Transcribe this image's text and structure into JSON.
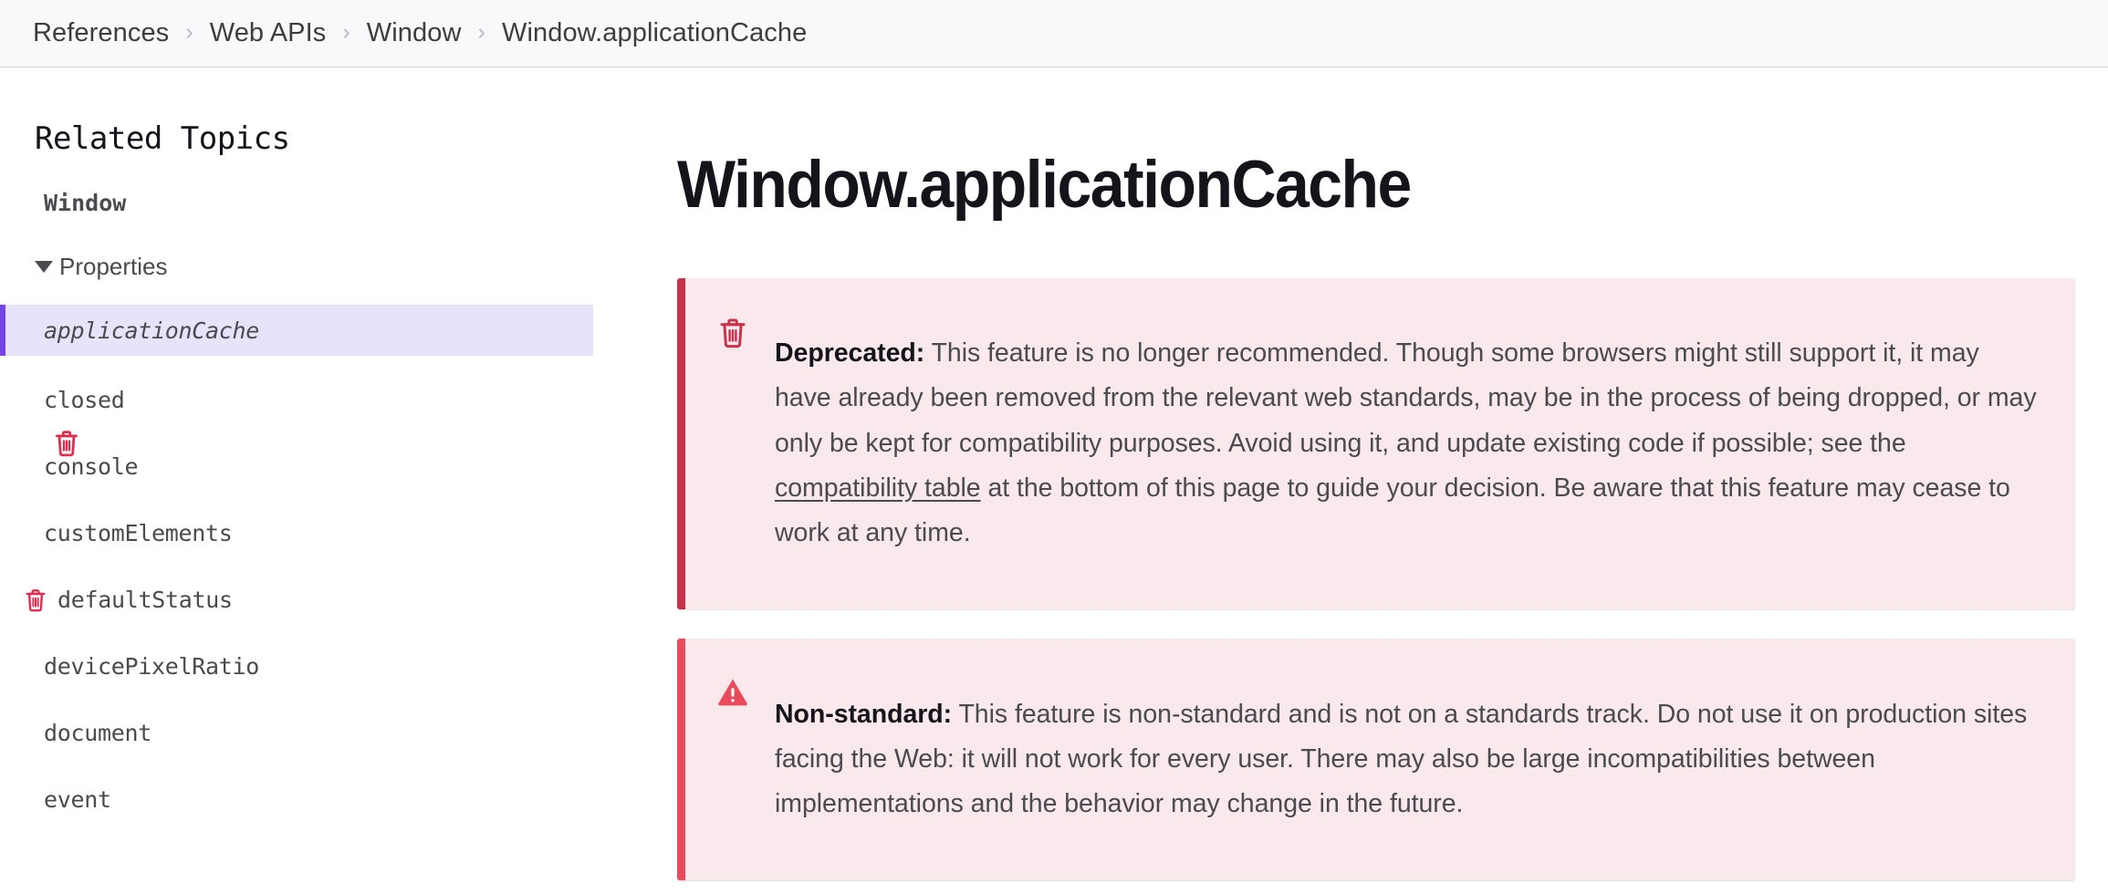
{
  "breadcrumb": {
    "separator": "›",
    "items": [
      {
        "label": "References",
        "current": false
      },
      {
        "label": "Web APIs",
        "current": false
      },
      {
        "label": "Window",
        "current": false
      },
      {
        "label": "Window.applicationCache",
        "current": true
      }
    ]
  },
  "sidebar": {
    "title": "Related Topics",
    "group_title": "Window",
    "section": {
      "label": "Properties",
      "expanded": true,
      "icon": "triangle-down-icon"
    },
    "properties": [
      {
        "label": "applicationCache",
        "active": true,
        "deprecated": true,
        "italic": true
      },
      {
        "label": "closed",
        "active": false,
        "deprecated": false
      },
      {
        "label": "console",
        "active": false,
        "deprecated": false
      },
      {
        "label": "customElements",
        "active": false,
        "deprecated": false
      },
      {
        "label": "defaultStatus",
        "active": false,
        "deprecated": true
      },
      {
        "label": "devicePixelRatio",
        "active": false,
        "deprecated": false
      },
      {
        "label": "document",
        "active": false,
        "deprecated": false
      },
      {
        "label": "event",
        "active": false,
        "deprecated": false
      }
    ]
  },
  "main": {
    "title": "Window.applicationCache",
    "notices": [
      {
        "kind": "deprecated",
        "icon": "trash-icon",
        "label": "Deprecated:",
        "text_before_link": " This feature is no longer recommended. Though some browsers might still support it, it may have already been removed from the relevant web standards, may be in the process of being dropped, or may only be kept for compatibility purposes. Avoid using it, and update existing code if possible; see the ",
        "link_text": "compatibility table",
        "text_after_link": " at the bottom of this page to guide your decision. Be aware that this feature may cease to work at any time."
      },
      {
        "kind": "nonstandard",
        "icon": "warning-triangle-icon",
        "label": "Non-standard:",
        "text_before_link": " This feature is non-standard and is not on a standards track. Do not use it on production sites facing the Web: it will not work for every user. There may also be large incompatibilities between implementations and the behavior may change in the future.",
        "link_text": "",
        "text_after_link": ""
      }
    ]
  },
  "colors": {
    "deprecated_border": "#c9304a",
    "nonstandard_border": "#ea4b5c",
    "notice_bg": "#f9e8ec",
    "icon_red": "#e02c4d",
    "active_bg": "#e9e2fb",
    "active_border": "#7544e5",
    "breadcrumb_bg": "#f9f9fb",
    "text": "#4a4a4f",
    "heading": "#15141a"
  }
}
